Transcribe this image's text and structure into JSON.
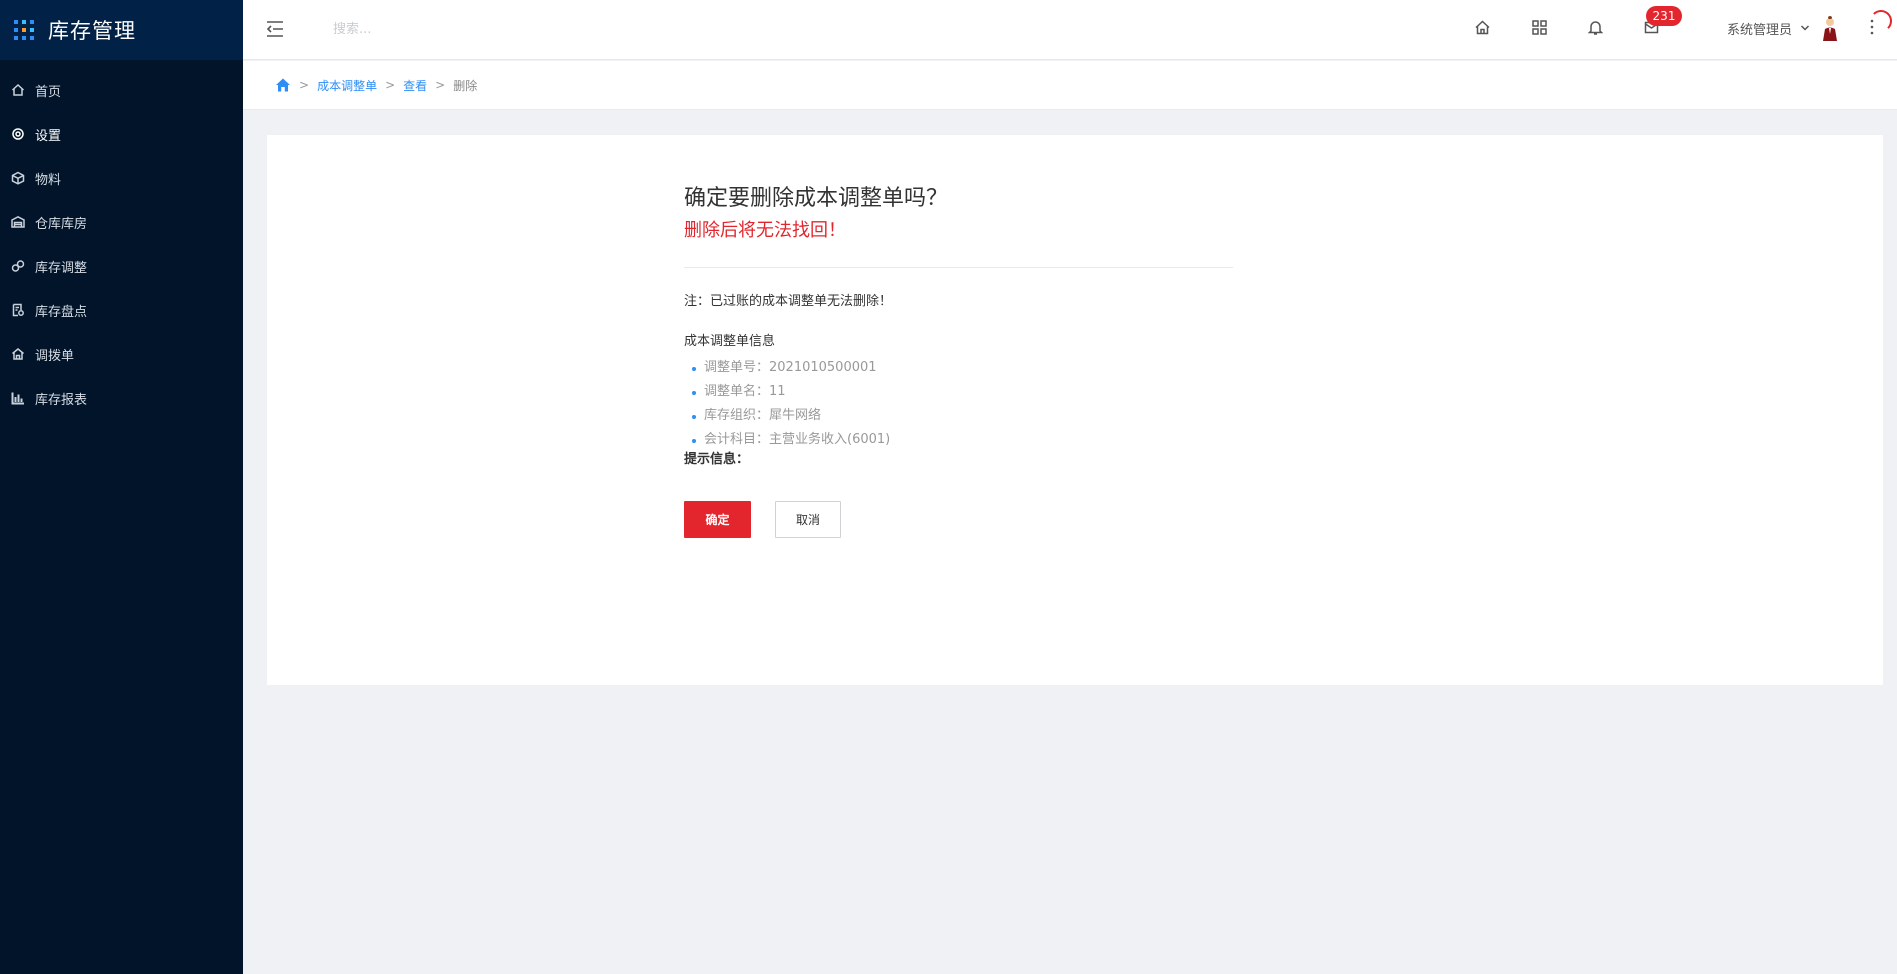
{
  "app": {
    "title": "库存管理"
  },
  "sidebar": {
    "items": [
      {
        "label": "首页",
        "icon": "home-icon"
      },
      {
        "label": "设置",
        "icon": "gear-icon"
      },
      {
        "label": "物料",
        "icon": "box-icon"
      },
      {
        "label": "仓库库房",
        "icon": "warehouse-icon"
      },
      {
        "label": "库存调整",
        "icon": "adjust-icon"
      },
      {
        "label": "库存盘点",
        "icon": "inventory-icon"
      },
      {
        "label": "调拨单",
        "icon": "transfer-icon"
      },
      {
        "label": "库存报表",
        "icon": "bar-chart-icon"
      }
    ],
    "active_index": 1
  },
  "topbar": {
    "search_placeholder": "搜索...",
    "notification_count": "231",
    "user_name": "系统管理员"
  },
  "breadcrumb": {
    "items": [
      "成本调整单",
      "查看"
    ],
    "current": "删除",
    "separator": ">"
  },
  "dialog": {
    "title": "确定要删除成本调整单吗？",
    "warning": "删除后将无法找回！",
    "note": "注：已过账的成本调整单无法删除！",
    "info_title": "成本调整单信息",
    "info_items": [
      "调整单号：2021010500001",
      "调整单名：11",
      "库存组织：犀牛网络",
      "会计科目：主营业务收入(6001)"
    ],
    "tip_label": "提示信息：",
    "confirm_label": "确定",
    "cancel_label": "取消"
  },
  "colors": {
    "sidebar_bg": "#011429",
    "brand_bg": "#012246",
    "accent_blue": "#2f8df6",
    "danger_red": "#e3262d"
  }
}
